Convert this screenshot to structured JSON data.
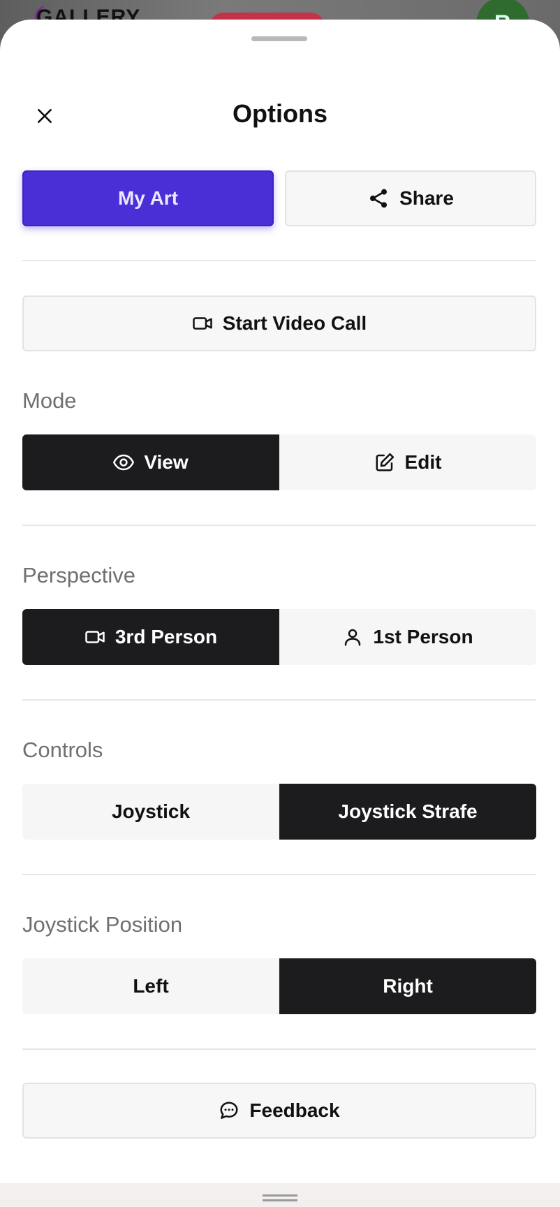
{
  "backdrop": {
    "logo_text": "GALLERY",
    "avatar_letter": "B"
  },
  "header": {
    "title": "Options"
  },
  "actions": {
    "my_art_label": "My Art",
    "share_label": "Share"
  },
  "video_call": {
    "label": "Start Video Call"
  },
  "mode": {
    "label": "Mode",
    "options": [
      "View",
      "Edit"
    ],
    "selected": "View"
  },
  "perspective": {
    "label": "Perspective",
    "options": [
      "3rd Person",
      "1st Person"
    ],
    "selected": "3rd Person"
  },
  "controls": {
    "label": "Controls",
    "options": [
      "Joystick",
      "Joystick Strafe"
    ],
    "selected": "Joystick Strafe"
  },
  "joystick_position": {
    "label": "Joystick Position",
    "options": [
      "Left",
      "Right"
    ],
    "selected": "Right"
  },
  "feedback": {
    "label": "Feedback"
  },
  "colors": {
    "accent": "#4a2ed6",
    "segment_active": "#1c1c1e"
  }
}
